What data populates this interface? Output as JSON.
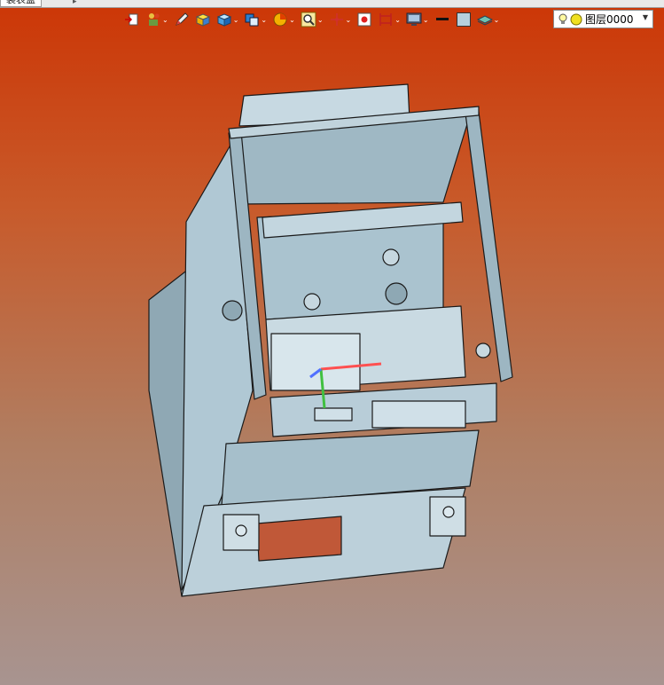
{
  "tab": {
    "label": "装表盒"
  },
  "toolbar": {
    "items": [
      {
        "icon": "exit-sketch-icon"
      },
      {
        "icon": "assembly-tree-icon"
      },
      {
        "icon": "pencil-icon"
      },
      {
        "icon": "cube-yellow-icon"
      },
      {
        "icon": "view-cube-icon"
      },
      {
        "icon": "section-view-icon"
      },
      {
        "icon": "pie-render-icon"
      },
      {
        "icon": "zoom-fit-icon"
      },
      {
        "icon": "move-axis-icon"
      },
      {
        "icon": "snapshot-icon"
      },
      {
        "icon": "frame-icon"
      },
      {
        "icon": "display-monitor-icon"
      },
      {
        "icon": "line-color-icon"
      },
      {
        "icon": "fill-color-icon"
      },
      {
        "icon": "layer-icon"
      }
    ]
  },
  "layer": {
    "value": "图层0000"
  },
  "colors": {
    "bg_top": "#cc3606",
    "bg_bottom": "#a89490",
    "model": "#b6d0dc"
  }
}
